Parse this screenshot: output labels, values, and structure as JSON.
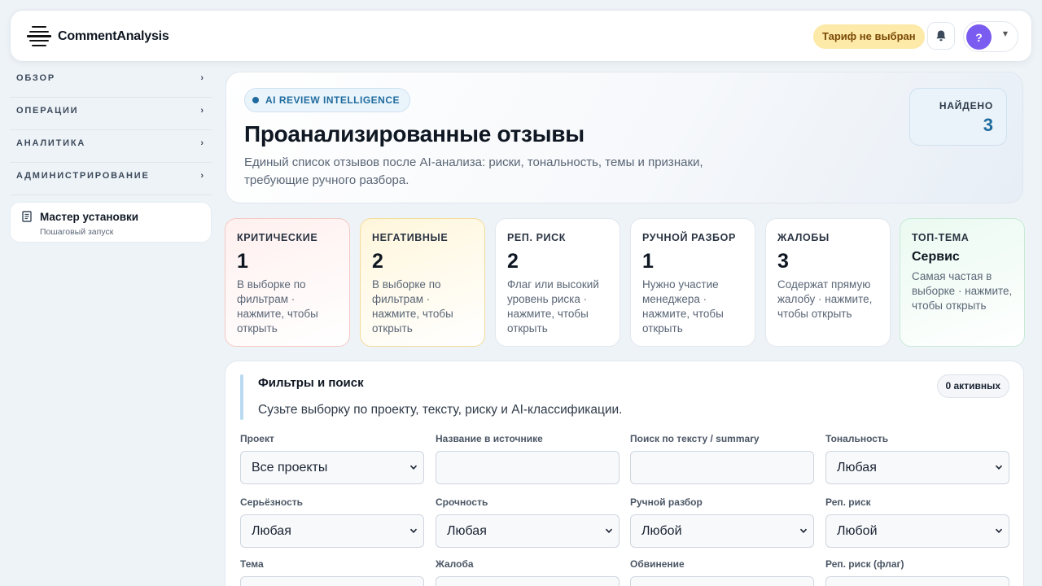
{
  "header": {
    "logo_text": "CommentAnalysis",
    "plan_badge": "Тариф не выбран",
    "user_initial": "?"
  },
  "sidebar": {
    "groups": [
      {
        "label": "ОБЗОР"
      },
      {
        "label": "ОПЕРАЦИИ"
      },
      {
        "label": "АНАЛИТИКА"
      },
      {
        "label": "АДМИНИСТРИРОВАНИЕ"
      }
    ],
    "chevron": "›",
    "wizard": {
      "title": "Мастер установки",
      "subtitle": "Пошаговый запуск"
    }
  },
  "hero": {
    "eyebrow": "AI REVIEW INTELLIGENCE",
    "title": "Проанализированные отзывы",
    "description": "Единый список отзывов после AI-анализа: риски, тональность, темы и признаки, требующие ручного разбора.",
    "found_label": "НАЙДЕНО",
    "found_value": "3"
  },
  "cards": [
    {
      "label": "КРИТИЧЕСКИЕ",
      "value": "1",
      "desc": "В выборке по фильтрам · нажмите, чтобы открыть"
    },
    {
      "label": "НЕГАТИВНЫЕ",
      "value": "2",
      "desc": "В выборке по фильтрам · нажмите, чтобы открыть"
    },
    {
      "label": "РЕП. РИСК",
      "value": "2",
      "desc": "Флаг или высокий уровень риска · нажмите, чтобы открыть"
    },
    {
      "label": "РУЧНОЙ РАЗБОР",
      "value": "1",
      "desc": "Нужно участие менеджера · нажмите, чтобы открыть"
    },
    {
      "label": "ЖАЛОБЫ",
      "value": "3",
      "desc": "Содержат прямую жалобу · нажмите, чтобы открыть"
    },
    {
      "label": "ТОП-ТЕМА",
      "value": "Сервис",
      "desc": "Самая частая в выборке · нажмите, чтобы открыть"
    }
  ],
  "filters": {
    "title": "Фильтры и поиск",
    "subtitle": "Сузьте выборку по проекту, тексту, риску и AI-классификации.",
    "active_badge": "0 активных",
    "fields": [
      {
        "label": "Проект",
        "value": "Все проекты",
        "kind": "select"
      },
      {
        "label": "Название в источнике",
        "value": "",
        "kind": "input"
      },
      {
        "label": "Поиск по тексту / summary",
        "value": "",
        "kind": "input"
      },
      {
        "label": "Тональность",
        "value": "Любая",
        "kind": "select"
      },
      {
        "label": "Серьёзность",
        "value": "Любая",
        "kind": "select"
      },
      {
        "label": "Срочность",
        "value": "Любая",
        "kind": "select"
      },
      {
        "label": "Ручной разбор",
        "value": "Любой",
        "kind": "select"
      },
      {
        "label": "Реп. риск",
        "value": "Любой",
        "kind": "select"
      },
      {
        "label": "Тема",
        "value": "",
        "kind": "select"
      },
      {
        "label": "Жалоба",
        "value": "",
        "kind": "select"
      },
      {
        "label": "Обвинение",
        "value": "",
        "kind": "select"
      },
      {
        "label": "Реп. риск (флаг)",
        "value": "",
        "kind": "select"
      }
    ]
  },
  "colors": {
    "accent": "#1f6b9e",
    "avatar": "#7b5cf0",
    "plan_badge_bg": "#fde9a8",
    "plan_badge_text": "#7a4a05"
  }
}
